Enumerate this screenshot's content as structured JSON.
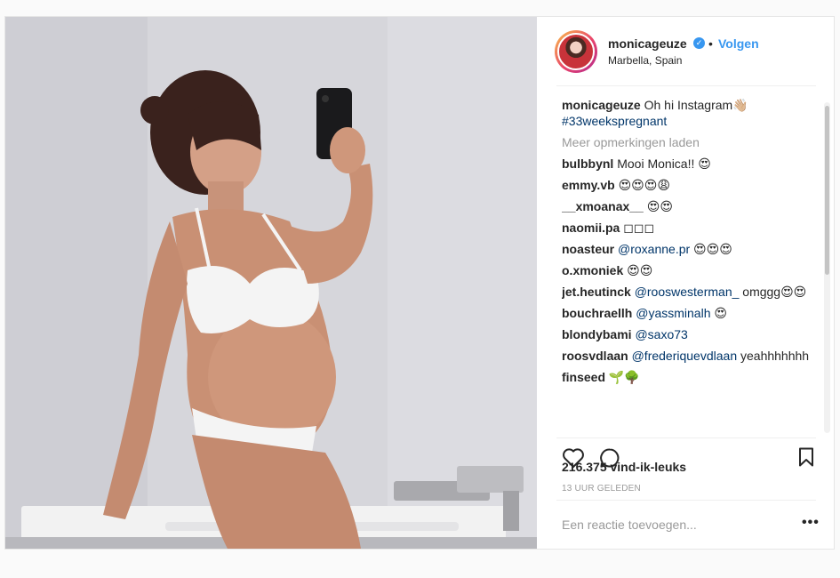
{
  "post": {
    "username": "monicageuze",
    "verified_mark": "✓",
    "separator": "•",
    "follow_label": "Volgen",
    "location": "Marbella, Spain",
    "caption_user": "monicageuze",
    "caption_text": "Oh hi Instagram👋🏼",
    "caption_hashtag": "#33weekspregnant",
    "load_more": "Meer opmerkingen laden",
    "comments": [
      {
        "user": "bulbbynl",
        "text": "Mooi Monica!! 😍"
      },
      {
        "user": "emmy.vb",
        "text": "😍😍😍😩"
      },
      {
        "user": "__xmoanax__",
        "text": "😍😍"
      },
      {
        "user": "naomii.pa",
        "text": "◻◻◻"
      },
      {
        "user": "noasteur",
        "mention": "@roxanne.pr",
        "text": " 😍😍😍"
      },
      {
        "user": "o.xmoniek",
        "text": "😍😍"
      },
      {
        "user": "jet.heutinck",
        "mention": "@rooswesterman_",
        "text": " omggg😍😍"
      },
      {
        "user": "bouchraellh",
        "mention": "@yassminalh",
        "text": " 😍"
      },
      {
        "user": "blondybami",
        "mention": "@saxo73",
        "text": ""
      },
      {
        "user": "roosvdlaan",
        "mention": "@frederiquevdlaan",
        "text": " yeahhhhhhh"
      },
      {
        "user": "finseed",
        "text": "🌱🌳"
      }
    ],
    "likes": "216.375 vind-ik-leuks",
    "time": "13 UUR GELEDEN",
    "add_comment_placeholder": "Een reactie toevoegen...",
    "more_options": "•••"
  },
  "icons": {
    "like": "heart-icon",
    "comment": "comment-bubble-icon",
    "save": "bookmark-icon"
  },
  "colors": {
    "accent": "#3897f0",
    "text": "#262626",
    "muted": "#999999",
    "mention": "#003569"
  }
}
